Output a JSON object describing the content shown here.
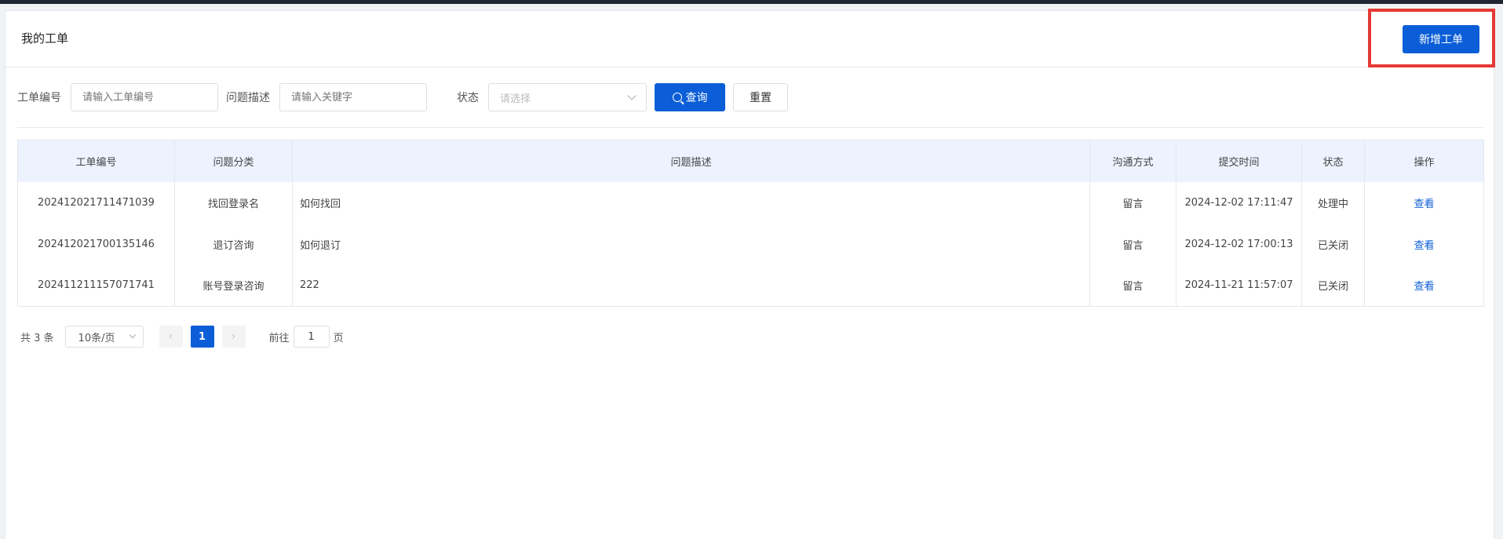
{
  "header": {
    "title": "我的工单",
    "add_button": "新增工单"
  },
  "filters": {
    "ticket_no_label": "工单编号",
    "ticket_no_placeholder": "请输入工单编号",
    "desc_label": "问题描述",
    "desc_placeholder": "请输入关键字",
    "status_label": "状态",
    "status_placeholder": "请选择",
    "query_button": "查询",
    "reset_button": "重置"
  },
  "table": {
    "headers": [
      "工单编号",
      "问题分类",
      "问题描述",
      "沟通方式",
      "提交时间",
      "状态",
      "操作"
    ],
    "rows": [
      {
        "id": "202412021711471039",
        "category": "找回登录名",
        "desc": "如何找回",
        "channel": "留言",
        "time": "2024-12-02 17:11:47",
        "status": "处理中",
        "action": "查看"
      },
      {
        "id": "202412021700135146",
        "category": "退订咨询",
        "desc": "如何退订",
        "channel": "留言",
        "time": "2024-12-02 17:00:13",
        "status": "已关闭",
        "action": "查看"
      },
      {
        "id": "202411211157071741",
        "category": "账号登录咨询",
        "desc": "222",
        "channel": "留言",
        "time": "2024-11-21 11:57:07",
        "status": "已关闭",
        "action": "查看"
      }
    ]
  },
  "pagination": {
    "total": "共 3 条",
    "page_size": "10条/页",
    "prev": "‹",
    "next": "›",
    "current": "1",
    "goto_label": "前往",
    "goto_value": "1",
    "page_suffix": "页"
  },
  "colors": {
    "primary": "#0b5ed7",
    "highlight": "#e53935",
    "table_header": "#ecf3fe"
  }
}
